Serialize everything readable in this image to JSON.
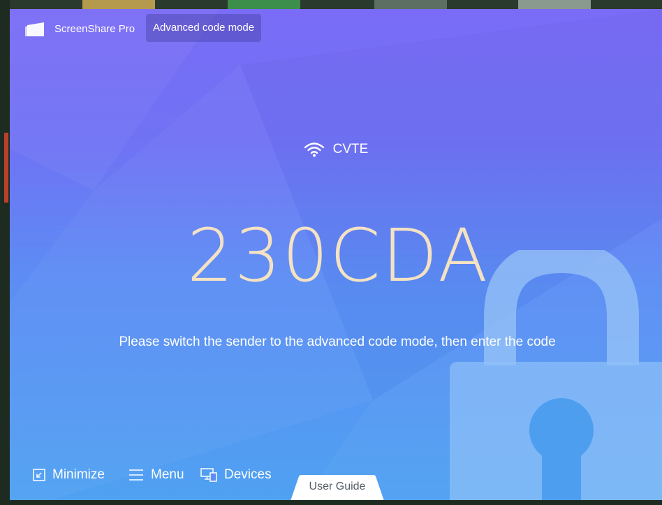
{
  "app": {
    "name": "ScreenShare Pro",
    "mode_badge": "Advanced code mode"
  },
  "network": {
    "icon": "wifi-icon",
    "ssid": "CVTE"
  },
  "code": {
    "value": "230CDA"
  },
  "instruction": "Please switch the sender to the advanced code mode, then enter the code",
  "bottom_bar": {
    "minimize": {
      "icon": "minimize-icon",
      "label": "Minimize"
    },
    "menu": {
      "icon": "menu-icon",
      "label": "Menu"
    },
    "devices": {
      "icon": "devices-icon",
      "label": "Devices"
    }
  },
  "user_guide": "User Guide",
  "colors": {
    "gradient_top": "#7a6cf6",
    "gradient_bottom": "#4fa1f2",
    "code_color": "#f4e2c3",
    "lock_color": "#8fc0f8"
  }
}
